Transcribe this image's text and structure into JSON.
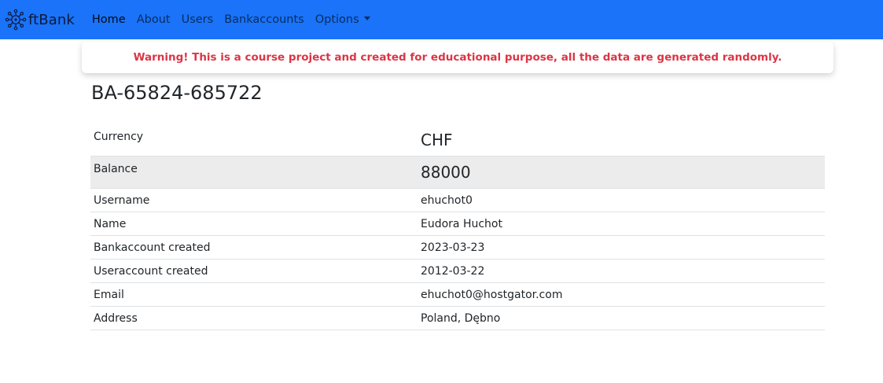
{
  "navbar": {
    "brand": "ftBank",
    "links": [
      {
        "label": "Home"
      },
      {
        "label": "About"
      },
      {
        "label": "Users"
      },
      {
        "label": "Bankaccounts"
      },
      {
        "label": "Options"
      }
    ],
    "color": "#1a73f8"
  },
  "warning": {
    "text": "Warning! This is a course project and created for educational purpose, all the data are generated randomly.",
    "color": "#dc3545"
  },
  "account": {
    "title": "BA-65824-685722",
    "rows": [
      {
        "key": "Currency",
        "value": "CHF"
      },
      {
        "key": "Balance",
        "value": "88000"
      },
      {
        "key": "Username",
        "value": "ehuchot0"
      },
      {
        "key": "Name",
        "value": "Eudora Huchot"
      },
      {
        "key": "Bankaccount created",
        "value": "2023-03-23"
      },
      {
        "key": "Useraccount created",
        "value": "2012-03-22"
      },
      {
        "key": "Email",
        "value": "ehuchot0@hostgator.com"
      },
      {
        "key": "Address",
        "value": "Poland, Dębno"
      }
    ]
  }
}
